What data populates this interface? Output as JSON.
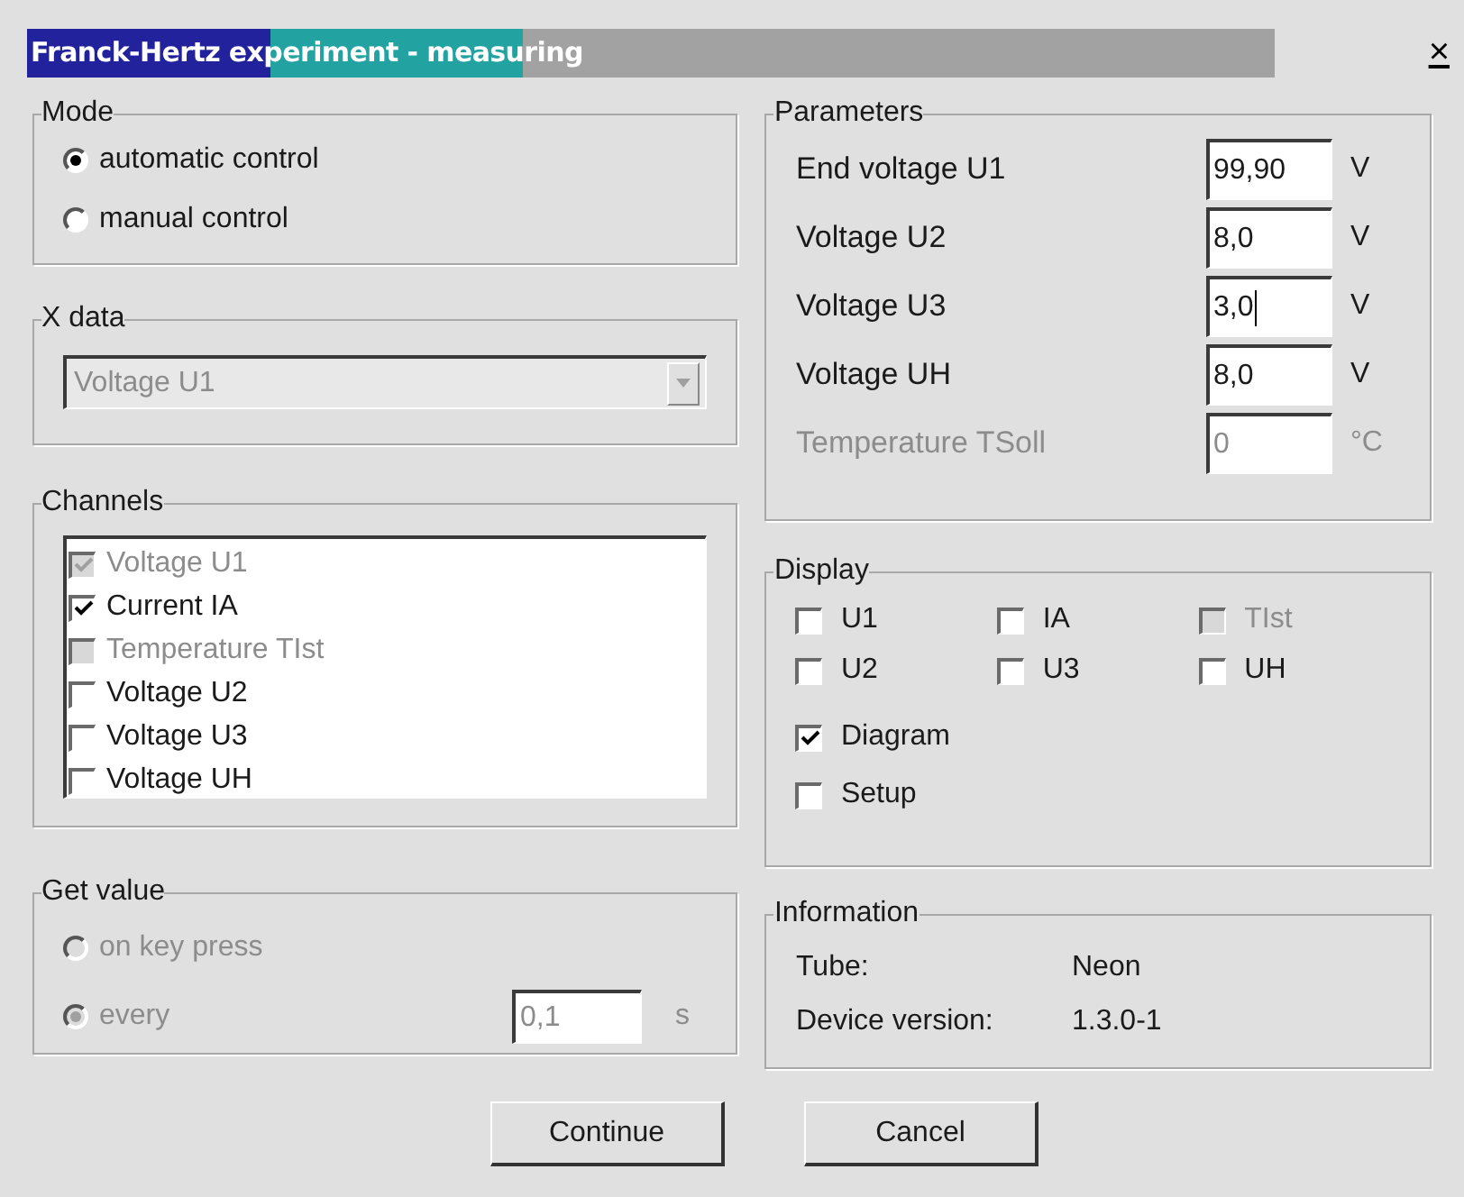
{
  "window": {
    "title": "Franck-Hertz experiment - measuring",
    "close": "×"
  },
  "mode": {
    "title": "Mode",
    "options": [
      {
        "label": "automatic control",
        "selected": true
      },
      {
        "label": "manual control",
        "selected": false
      }
    ]
  },
  "x_data": {
    "title": "X data",
    "value": "Voltage U1",
    "disabled": true
  },
  "channels": {
    "title": "Channels",
    "items": [
      {
        "label": "Voltage U1",
        "checked": true,
        "disabled": true
      },
      {
        "label": "Current IA",
        "checked": true,
        "disabled": false
      },
      {
        "label": "Temperature TIst",
        "checked": false,
        "disabled": true
      },
      {
        "label": "Voltage U2",
        "checked": false,
        "disabled": false
      },
      {
        "label": "Voltage U3",
        "checked": false,
        "disabled": false
      },
      {
        "label": "Voltage UH",
        "checked": false,
        "disabled": false
      }
    ]
  },
  "get_value": {
    "title": "Get value",
    "disabled": true,
    "options": [
      {
        "label": "on key press",
        "selected": false
      },
      {
        "label": "every",
        "selected": true
      }
    ],
    "interval": {
      "value": "0,1",
      "unit": "s"
    }
  },
  "parameters": {
    "title": "Parameters",
    "rows": [
      {
        "label": "End voltage U1",
        "value": "99,90",
        "unit": "V",
        "disabled": false,
        "focused": false
      },
      {
        "label": "Voltage U2",
        "value": "8,0",
        "unit": "V",
        "disabled": false,
        "focused": false
      },
      {
        "label": "Voltage U3",
        "value": "3,0",
        "unit": "V",
        "disabled": false,
        "focused": true
      },
      {
        "label": "Voltage UH",
        "value": "8,0",
        "unit": "V",
        "disabled": false,
        "focused": false
      },
      {
        "label": "Temperature TSoll",
        "value": "0",
        "unit": "°C",
        "disabled": true,
        "focused": false
      }
    ]
  },
  "display": {
    "title": "Display",
    "checks": [
      {
        "label": "U1",
        "checked": false,
        "disabled": false
      },
      {
        "label": "IA",
        "checked": false,
        "disabled": false
      },
      {
        "label": "TIst",
        "checked": false,
        "disabled": true
      },
      {
        "label": "U2",
        "checked": false,
        "disabled": false
      },
      {
        "label": "U3",
        "checked": false,
        "disabled": false
      },
      {
        "label": "UH",
        "checked": false,
        "disabled": false
      }
    ],
    "options": [
      {
        "label": "Diagram",
        "checked": true
      },
      {
        "label": "Setup",
        "checked": false
      }
    ]
  },
  "information": {
    "title": "Information",
    "rows": [
      {
        "label": "Tube:",
        "value": "Neon"
      },
      {
        "label": "Device version:",
        "value": "1.3.0-1"
      }
    ]
  },
  "buttons": [
    "Continue",
    "Cancel"
  ]
}
